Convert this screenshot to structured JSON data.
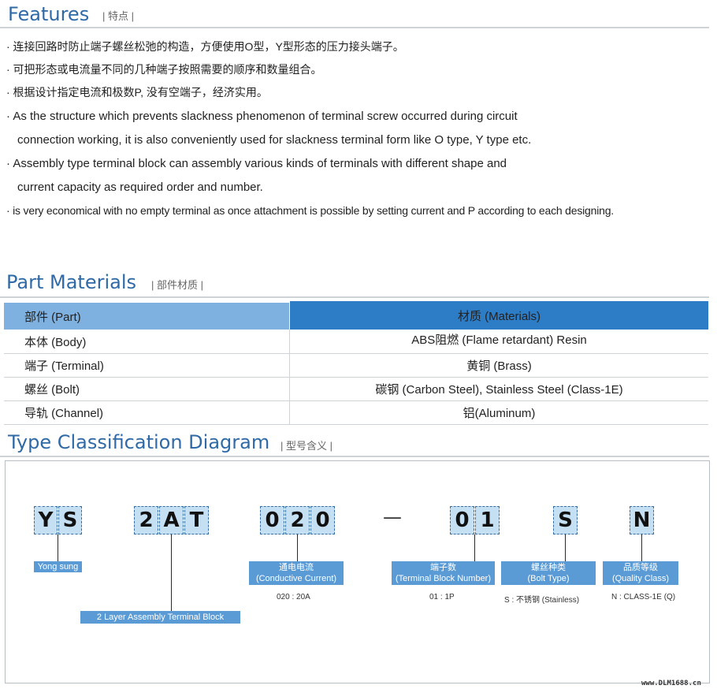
{
  "features": {
    "title": "Features",
    "subtitle": "| 特点 |",
    "bullets_cn": [
      "· 连接回路时防止端子螺丝松弛的构造，方便使用O型，Y型形态的压力接头端子。",
      "· 可把形态或电流量不同的几种端子按照需要的顺序和数量组合。",
      "· 根据设计指定电流和极数P, 没有空端子，经济实用。"
    ],
    "bullets_en": [
      "· As the structure which prevents slackness phenomenon of terminal screw occurred during circuit",
      "connection working, it is also conveniently used for slackness terminal form like O type, Y type etc.",
      "· Assembly type terminal block can assembly various kinds of terminals with different shape and",
      "current capacity as required order and number.",
      "·  is very economical with no empty terminal as once attachment is possible by setting current and P according to each designing."
    ]
  },
  "materials": {
    "title": "Part Materials",
    "subtitle": "| 部件材质 |",
    "header_part": "部件 (Part)",
    "header_materials": "材质 (Materials)",
    "rows": [
      {
        "part": "本体 (Body)",
        "material": "ABS阻燃 (Flame retardant) Resin"
      },
      {
        "part": "端子 (Terminal)",
        "material": "黄铜 (Brass)"
      },
      {
        "part": "螺丝 (Bolt)",
        "material": "碳钢 (Carbon Steel), Stainless Steel (Class-1E)"
      },
      {
        "part": "导轨 (Channel)",
        "material": "铝(Aluminum)"
      }
    ]
  },
  "type": {
    "title": "Type Classification Diagram",
    "subtitle": "| 型号含义 |",
    "codes": {
      "g1": [
        "Y",
        "S"
      ],
      "g2": [
        "2",
        "A",
        "T"
      ],
      "g3": [
        "0",
        "2",
        "0"
      ],
      "dash": "—",
      "g4": [
        "0",
        "1"
      ],
      "g5": [
        "S"
      ],
      "g6": [
        "N"
      ]
    },
    "labels": {
      "yong": "Yong sung",
      "layer": "2 Layer Assembly Terminal Block",
      "current_cn": "通电电流",
      "current_en": "(Conductive Current)",
      "tbn_cn": "端子数",
      "tbn_en": "(Terminal Block Number)",
      "bolt_cn": "螺丝种类",
      "bolt_en": "(Bolt Type)",
      "qual_cn": "品质等级",
      "qual_en": "(Quality Class)"
    },
    "notes": {
      "current": "020 : 20A",
      "tbn": "01 : 1P",
      "bolt": "S : 不锈钢 (Stainless)",
      "qual": "N : CLASS-1E (Q)"
    }
  },
  "watermark": "www.DLM1688.cn"
}
